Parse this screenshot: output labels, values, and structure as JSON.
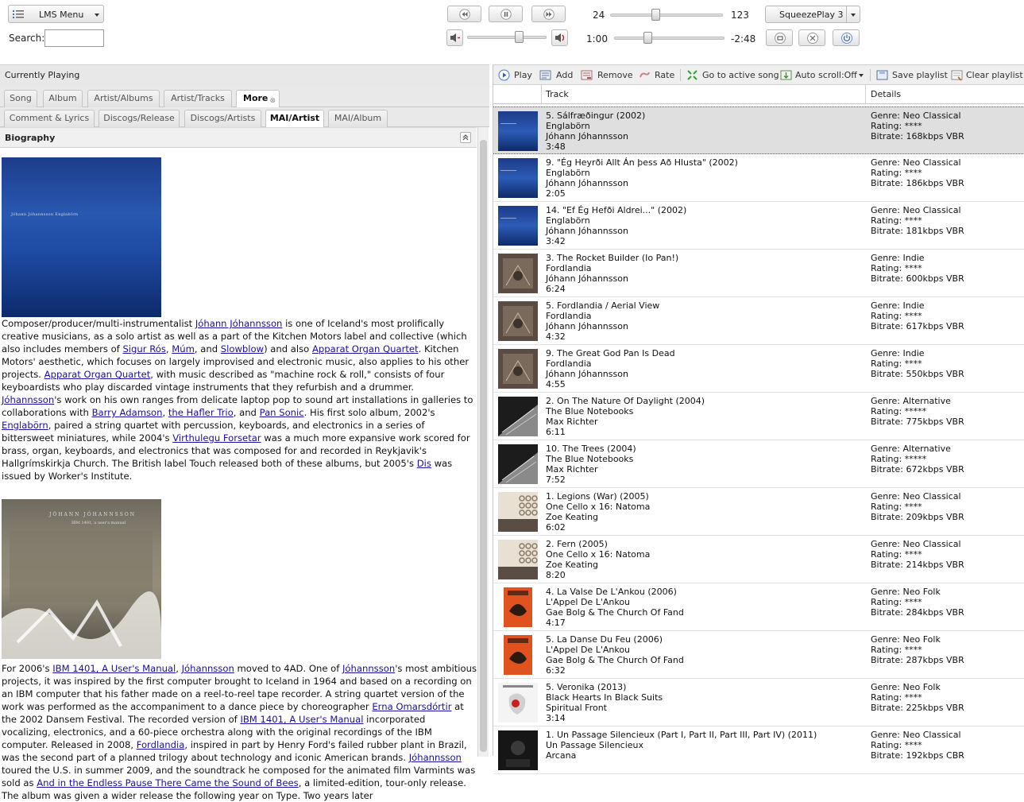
{
  "toolbar": {
    "menu_label": "LMS Menu",
    "search_label": "Search:",
    "search_value": "",
    "elapsed_track": "24",
    "total_track": "123",
    "elapsed_time": "1:00",
    "remaining_time": "-2:48",
    "player": "SqueezePlay 3",
    "track_position_fraction": 0.39,
    "volume_fraction": 0.66,
    "song_progress_fraction": 0.28
  },
  "left": {
    "header": "Currently Playing",
    "tabs1": [
      "Song",
      "Album",
      "Artist/Albums",
      "Artist/Tracks",
      "More"
    ],
    "tabs2": [
      "Comment & Lyrics",
      "Discogs/Release",
      "Discogs/Artists",
      "MAI/Artist",
      "MAI/Album"
    ],
    "panel_title": "Biography",
    "cover1_text": "Jóhann Jóhannsson    Englabörn",
    "cover2_text1": "JÓHANN JÓHANNSSON",
    "cover2_text2": "IBM 1401, a user's manual",
    "para1": [
      {
        "t": "Composer/producer/multi-instrumentalist "
      },
      {
        "t": "Jóhann Jóhannsson",
        "link": true
      },
      {
        "t": " is one of Iceland's most prolifically creative musicians, as a solo artist as well as a part of the Kitchen Motors label and collective (which also includes members of "
      },
      {
        "t": "Sigur Rós",
        "link": true
      },
      {
        "t": ", "
      },
      {
        "t": "Múm",
        "link": true
      },
      {
        "t": ", and "
      },
      {
        "t": "Slowblow",
        "link": true
      },
      {
        "t": ") and also "
      },
      {
        "t": "Apparat Organ Quartet",
        "link": true
      },
      {
        "t": ". Kitchen Motors' aesthetic, which focuses on largely improvised and electronic music, also applies to his other projects. "
      },
      {
        "t": "Apparat Organ Quartet",
        "link": true
      },
      {
        "t": ", with music described as \"machine rock & roll,\" consists of four keyboardists who play discarded vintage instruments that they refurbish and a drummer. "
      },
      {
        "t": "Jóhannsson",
        "link": true
      },
      {
        "t": "'s work on his own ranges from delicate laptop pop to sound art installations in galleries to collaborations with "
      },
      {
        "t": "Barry Adamson",
        "link": true
      },
      {
        "t": ", "
      },
      {
        "t": "the Hafler Trio",
        "link": true
      },
      {
        "t": ", and "
      },
      {
        "t": "Pan Sonic",
        "link": true
      },
      {
        "t": ". His first solo album, 2002's "
      },
      {
        "t": "Englabörn",
        "link": true
      },
      {
        "t": ", paired a string quartet with percussion, keyboards, and electronics in a series of bittersweet miniatures, while 2004's "
      },
      {
        "t": "Virthulegu Forsetar",
        "link": true
      },
      {
        "t": " was a much more expansive work scored for brass, organ, keyboards, and electronics that was composed for and recorded in Reykjavik's Hallgrímskirkja Church. The British label Touch released both of these albums, but 2005's "
      },
      {
        "t": "Dis",
        "link": true
      },
      {
        "t": " was issued by Worker's Institute."
      }
    ],
    "para2": [
      {
        "t": "For 2006's "
      },
      {
        "t": "IBM 1401, A User's Manual",
        "link": true
      },
      {
        "t": ", "
      },
      {
        "t": "Jóhannsson",
        "link": true
      },
      {
        "t": " moved to 4AD. One of "
      },
      {
        "t": "Jóhannsson",
        "link": true
      },
      {
        "t": "'s most ambitious projects, it was inspired by the first computer brought to Iceland in 1964 and based on a recording on an IBM computer that his father made on a reel-to-reel tape recorder. A string quartet version of the work was performed as the accompaniment to a dance piece by choreographer "
      },
      {
        "t": "Erna Omarsdórtir",
        "link": true
      },
      {
        "t": " at the 2002 Dansem Festival. The recorded version of "
      },
      {
        "t": "IBM 1401, A User's Manual",
        "link": true
      },
      {
        "t": " incorporated vocalizing, electronics, and a 60-piece orchestra along with the original recordings of the IBM computer. Released in 2008, "
      },
      {
        "t": "Fordlandia",
        "link": true
      },
      {
        "t": ", inspired in part by Henry Ford's failed rubber plant in Brazil, was the second part of a planned trilogy about technology and iconic American brands. "
      },
      {
        "t": "Jóhannsson",
        "link": true
      },
      {
        "t": " toured the U.S. in summer 2009, and the soundtrack he composed for the animated film Varmints was sold as "
      },
      {
        "t": "And in the Endless Pause There Came the Sound of Bees",
        "link": true
      },
      {
        "t": ", a limited-edition, tour-only release. The album was given a wider release the following year on Type. Two years later"
      }
    ]
  },
  "right": {
    "toolbar": [
      "Play",
      "Add",
      "Remove",
      "Rate",
      "Go to active song",
      "Auto scroll:Off",
      "Save playlist",
      "Clear playlist"
    ],
    "columns": [
      "Track",
      "Details"
    ],
    "tracks": [
      {
        "title": "5. Sálfræðingur (2002)",
        "album": "Englabörn",
        "artist": "Jóhann Jóhannsson",
        "time": "3:48",
        "genre": "Genre: Neo Classical",
        "rating": "Rating: ****",
        "bitrate": "Bitrate: 168kbps VBR",
        "art": "blue",
        "active": true
      },
      {
        "title": "9. \"Ég Heyrði Allt Án þess Að Hlusta\" (2002)",
        "album": "Englabörn",
        "artist": "Jóhann Jóhannsson",
        "time": "2:05",
        "genre": "Genre: Neo Classical",
        "rating": "Rating: ****",
        "bitrate": "Bitrate: 186kbps VBR",
        "art": "blue"
      },
      {
        "title": "14. \"Ef Ég Hefði Aldrei...\" (2002)",
        "album": "Englabörn",
        "artist": "Jóhann Jóhannsson",
        "time": "3:42",
        "genre": "Genre: Neo Classical",
        "rating": "Rating: ****",
        "bitrate": "Bitrate: 181kbps VBR",
        "art": "blue"
      },
      {
        "title": "3. The Rocket Builder (Io Pan!)",
        "album": "Fordlandia",
        "artist": "Jóhann Jóhannsson",
        "time": "6:24",
        "genre": "Genre: Indie",
        "rating": "Rating: ****",
        "bitrate": "Bitrate: 600kbps VBR",
        "art": "brown"
      },
      {
        "title": "5. Fordlandia / Aerial View",
        "album": "Fordlandia",
        "artist": "Jóhann Jóhannsson",
        "time": "4:32",
        "genre": "Genre: Indie",
        "rating": "Rating: ****",
        "bitrate": "Bitrate: 617kbps VBR",
        "art": "brown"
      },
      {
        "title": "9. The Great God Pan Is Dead",
        "album": "Fordlandia",
        "artist": "Jóhann Jóhannsson",
        "time": "4:55",
        "genre": "Genre: Indie",
        "rating": "Rating: ****",
        "bitrate": "Bitrate: 550kbps VBR",
        "art": "brown"
      },
      {
        "title": "2. On The Nature Of Daylight (2004)",
        "album": "The Blue Notebooks",
        "artist": "Max Richter",
        "time": "6:11",
        "genre": "Genre: Alternative",
        "rating": "Rating: *****",
        "bitrate": "Bitrate: 775kbps VBR",
        "art": "bw"
      },
      {
        "title": "10. The Trees (2004)",
        "album": "The Blue Notebooks",
        "artist": "Max Richter",
        "time": "7:52",
        "genre": "Genre: Alternative",
        "rating": "Rating: *****",
        "bitrate": "Bitrate: 672kbps VBR",
        "art": "bw"
      },
      {
        "title": "1. Legions (War) (2005)",
        "album": "One Cello x 16: Natoma",
        "artist": "Zoe Keating",
        "time": "6:02",
        "genre": "Genre: Neo Classical",
        "rating": "Rating: ****",
        "bitrate": "Bitrate: 209kbps VBR",
        "art": "cream"
      },
      {
        "title": "2. Fern (2005)",
        "album": "One Cello x 16: Natoma",
        "artist": "Zoe Keating",
        "time": "8:20",
        "genre": "Genre: Neo Classical",
        "rating": "Rating: ****",
        "bitrate": "Bitrate: 214kbps VBR",
        "art": "cream"
      },
      {
        "title": "4. La Valse De L'Ankou (2006)",
        "album": "L'Appel De L'Ankou",
        "artist": "Gae Bolg & The Church Of Fand",
        "time": "4:17",
        "genre": "Genre: Neo Folk",
        "rating": "Rating: ****",
        "bitrate": "Bitrate: 284kbps VBR",
        "art": "orange"
      },
      {
        "title": "5. La Danse Du Feu (2006)",
        "album": "L'Appel De L'Ankou",
        "artist": "Gae Bolg & The Church Of Fand",
        "time": "6:32",
        "genre": "Genre: Neo Folk",
        "rating": "Rating: ****",
        "bitrate": "Bitrate: 287kbps VBR",
        "art": "orange"
      },
      {
        "title": "5. Veronika (2013)",
        "album": "Black Hearts In Black Suits",
        "artist": "Spiritual Front",
        "time": "3:14",
        "genre": "Genre: Neo Folk",
        "rating": "Rating: ****",
        "bitrate": "Bitrate: 225kbps VBR",
        "art": "white"
      },
      {
        "title": "1. Un Passage Silencieux (Part I, Part II, Part III, Part IV) (2011)",
        "album": "Un Passage Silencieux",
        "artist": "Arcana",
        "time": "",
        "genre": "Genre: Neo Classical",
        "rating": "Rating: ****",
        "bitrate": "Bitrate: 192kbps CBR",
        "art": "dark"
      }
    ]
  }
}
